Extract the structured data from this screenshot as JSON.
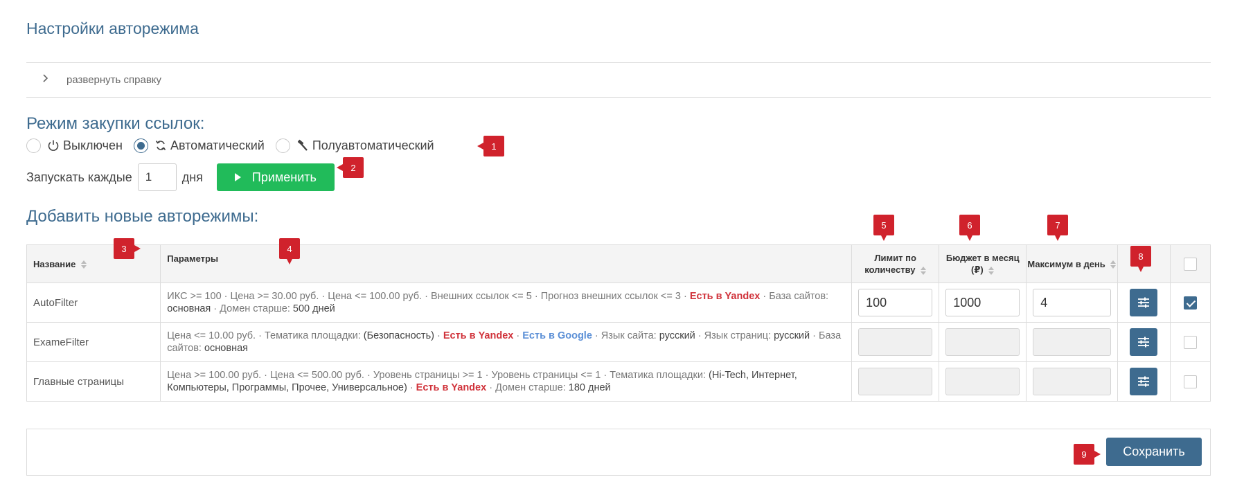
{
  "page_title": "Настройки авторежима",
  "help": {
    "toggle_label": "развернуть справку"
  },
  "purchase_mode": {
    "title": "Режим закупки ссылок:",
    "options": [
      {
        "label": "Выключен",
        "icon": "power-icon",
        "selected": false
      },
      {
        "label": "Автоматический",
        "icon": "refresh-icon",
        "selected": true
      },
      {
        "label": "Полуавтоматический",
        "icon": "hammer-icon",
        "selected": false
      }
    ]
  },
  "launch": {
    "label_before": "Запускать каждые",
    "days_value": "1",
    "label_after": "дня",
    "apply_label": "Применить"
  },
  "new_automodes": {
    "title": "Добавить новые авторежимы:",
    "columns": {
      "name": "Название",
      "params": "Параметры",
      "limit": "Лимит по количеству",
      "budget": "Бюджет в месяц (₽)",
      "max_day": "Максимум в день"
    },
    "rows": [
      {
        "name": "AutoFilter",
        "params": [
          {
            "text": "ИКС >= 100"
          },
          {
            "text": "Цена >= 30.00 руб."
          },
          {
            "text": "Цена <= 100.00 руб."
          },
          {
            "text": "Внешних ссылок <= 5"
          },
          {
            "text": "Прогноз внешних ссылок <= 3"
          },
          {
            "text": "Есть в Yandex",
            "style": "red"
          },
          {
            "label": "База сайтов: ",
            "value": "основная"
          },
          {
            "label": "Домен старше: ",
            "value": "500 дней"
          }
        ],
        "limit": "100",
        "budget": "1000",
        "max_day": "4",
        "editable": true,
        "checked": true
      },
      {
        "name": "ExameFilter",
        "params": [
          {
            "text": "Цена <= 10.00 руб."
          },
          {
            "label": "Тематика площадки: ",
            "value": "(Безопасность)"
          },
          {
            "text": "Есть в Yandex",
            "style": "red"
          },
          {
            "text": "Есть в Google",
            "style": "blue"
          },
          {
            "label": "Язык сайта: ",
            "value": "русский"
          },
          {
            "label": "Язык страниц: ",
            "value": "русский"
          },
          {
            "label": "База сайтов: ",
            "value": "основная"
          }
        ],
        "limit": "",
        "budget": "",
        "max_day": "",
        "editable": false,
        "checked": false
      },
      {
        "name": "Главные страницы",
        "params": [
          {
            "text": "Цена >= 100.00 руб."
          },
          {
            "text": "Цена <= 500.00 руб."
          },
          {
            "text": "Уровень страницы >= 1"
          },
          {
            "text": "Уровень страницы <= 1"
          },
          {
            "label": "Тематика площадки: ",
            "value": "(Hi-Tech, Интернет, Компьютеры, Программы, Прочее, Универсальное)"
          },
          {
            "text": "Есть в Yandex",
            "style": "red"
          },
          {
            "label": "Домен старше: ",
            "value": "180 дней"
          }
        ],
        "limit": "",
        "budget": "",
        "max_day": "",
        "editable": false,
        "checked": false
      }
    ]
  },
  "save_label": "Сохранить",
  "markers": [
    "1",
    "2",
    "3",
    "4",
    "5",
    "6",
    "7",
    "8",
    "9"
  ],
  "colors": {
    "accent": "#3e6b8f",
    "apply": "#21bb5a",
    "marker": "#d0222c",
    "yandex": "#d0323a",
    "google": "#5b8fd6"
  }
}
